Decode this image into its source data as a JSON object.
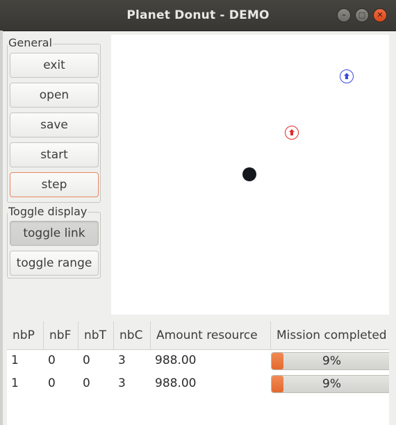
{
  "window": {
    "title": "Planet Donut - DEMO"
  },
  "general": {
    "label": "General",
    "buttons": {
      "exit": "exit",
      "open": "open",
      "save": "save",
      "start": "start",
      "step": "step"
    }
  },
  "toggle_display": {
    "label": "Toggle display",
    "buttons": {
      "link": "toggle link",
      "range": "toggle range"
    },
    "link_active": true
  },
  "world": {
    "robots": [
      {
        "color": "#3a48e0",
        "kind": "robot"
      },
      {
        "color": "#e02a2a",
        "kind": "robot"
      }
    ],
    "base_color": "#14181c"
  },
  "table": {
    "headers": [
      "nbP",
      "nbF",
      "nbT",
      "nbC",
      "Amount resource",
      "Mission completed"
    ],
    "rows": [
      {
        "nbP": "1",
        "nbF": "0",
        "nbT": "0",
        "nbC": "3",
        "amount": "988.00",
        "mission": 0.09,
        "mission_label": "9%"
      },
      {
        "nbP": "1",
        "nbF": "0",
        "nbT": "0",
        "nbC": "3",
        "amount": "988.00",
        "mission": 0.09,
        "mission_label": "9%"
      }
    ],
    "progress_color": "#e4692f"
  }
}
